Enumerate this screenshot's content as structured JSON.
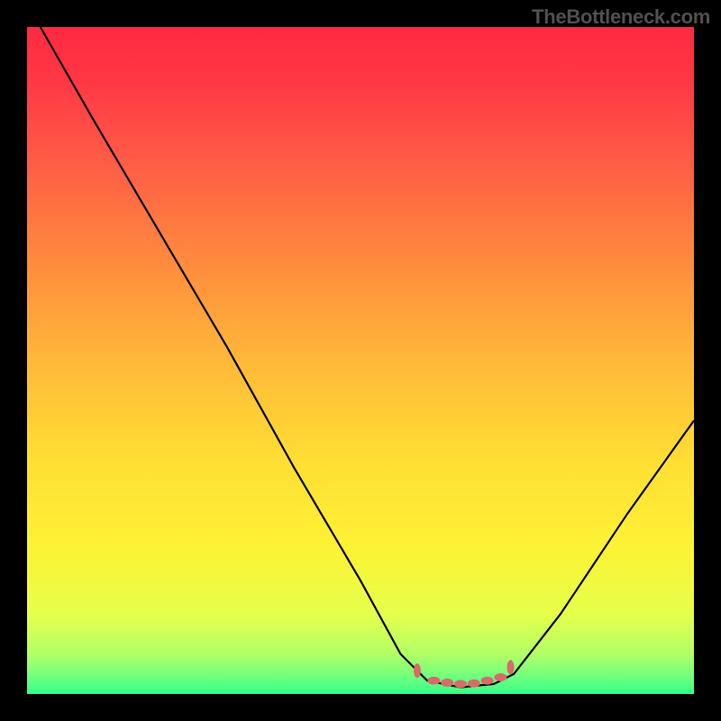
{
  "watermark": "TheBottleneck.com",
  "chart_data": {
    "type": "line",
    "title": "",
    "xlabel": "",
    "ylabel": "",
    "xlim": [
      0,
      1
    ],
    "ylim": [
      0,
      1
    ],
    "series": [
      {
        "name": "curve",
        "color": "#000000",
        "points": [
          {
            "x": 0.02,
            "y": 1.0
          },
          {
            "x": 0.1,
            "y": 0.86
          },
          {
            "x": 0.2,
            "y": 0.69
          },
          {
            "x": 0.3,
            "y": 0.52
          },
          {
            "x": 0.4,
            "y": 0.34
          },
          {
            "x": 0.5,
            "y": 0.17
          },
          {
            "x": 0.56,
            "y": 0.06
          },
          {
            "x": 0.6,
            "y": 0.02
          },
          {
            "x": 0.65,
            "y": 0.01
          },
          {
            "x": 0.7,
            "y": 0.015
          },
          {
            "x": 0.73,
            "y": 0.03
          },
          {
            "x": 0.8,
            "y": 0.12
          },
          {
            "x": 0.9,
            "y": 0.27
          },
          {
            "x": 1.0,
            "y": 0.41
          }
        ]
      },
      {
        "name": "highlight-markers",
        "color": "#d96a6a",
        "points": [
          {
            "x": 0.585,
            "y": 0.035
          },
          {
            "x": 0.61,
            "y": 0.02
          },
          {
            "x": 0.63,
            "y": 0.017
          },
          {
            "x": 0.65,
            "y": 0.015
          },
          {
            "x": 0.67,
            "y": 0.016
          },
          {
            "x": 0.69,
            "y": 0.02
          },
          {
            "x": 0.71,
            "y": 0.025
          },
          {
            "x": 0.725,
            "y": 0.04
          }
        ]
      }
    ],
    "background_gradient": {
      "stops": [
        {
          "offset": 0.0,
          "color": "#ff2a40"
        },
        {
          "offset": 0.08,
          "color": "#ff3745"
        },
        {
          "offset": 0.2,
          "color": "#ff5b46"
        },
        {
          "offset": 0.35,
          "color": "#ff8a3e"
        },
        {
          "offset": 0.5,
          "color": "#ffb839"
        },
        {
          "offset": 0.65,
          "color": "#ffde33"
        },
        {
          "offset": 0.78,
          "color": "#fdf235"
        },
        {
          "offset": 0.88,
          "color": "#e6ff4a"
        },
        {
          "offset": 0.94,
          "color": "#b2ff66"
        },
        {
          "offset": 0.975,
          "color": "#6eff7e"
        },
        {
          "offset": 1.0,
          "color": "#33ff88"
        }
      ]
    }
  }
}
